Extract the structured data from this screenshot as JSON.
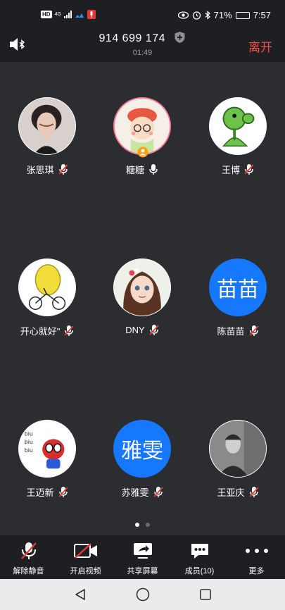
{
  "status_bar": {
    "hd_badge": "HD",
    "network": "4G",
    "battery_percent": "71%",
    "battery_level": 0.71,
    "time": "7:57"
  },
  "meeting": {
    "meeting_id": "914 699 174",
    "duration": "01:49",
    "leave_label": "离开"
  },
  "participants": [
    {
      "name": "张思琪",
      "avatar_type": "photo",
      "avatar_icon": "woman-photo",
      "muted": true
    },
    {
      "name": "糖糖",
      "avatar_type": "photo",
      "avatar_icon": "cartoon-girl",
      "muted": false,
      "host": true
    },
    {
      "name": "王博",
      "avatar_type": "photo",
      "avatar_icon": "peashooter-plant",
      "muted": true
    },
    {
      "name": "开心就好\"",
      "avatar_type": "photo",
      "avatar_icon": "lemon-bicycle",
      "muted": true
    },
    {
      "name": "DNY",
      "avatar_type": "photo",
      "avatar_icon": "doll-girl",
      "muted": true
    },
    {
      "name": "陈苗苗",
      "avatar_type": "text",
      "avatar_text": "苗苗",
      "muted": true
    },
    {
      "name": "王迈新",
      "avatar_type": "photo",
      "avatar_icon": "spiderman-cartoon",
      "muted": true
    },
    {
      "name": "苏雅雯",
      "avatar_type": "text",
      "avatar_text": "雅雯",
      "muted": true
    },
    {
      "name": "王亚庆",
      "avatar_type": "photo",
      "avatar_icon": "man-bw-photo",
      "muted": true
    }
  ],
  "pagination": {
    "current": 1,
    "total": 2
  },
  "toolbar": {
    "unmute_label": "解除静音",
    "video_label": "开启视频",
    "share_label": "共享屏幕",
    "members_label": "成员(10)",
    "more_label": "更多"
  },
  "colors": {
    "background": "#2b2d31",
    "bar": "#1e1f22",
    "accent_blue": "#1677ff",
    "leave_red": "#f25249",
    "muted_red": "#e53935"
  }
}
